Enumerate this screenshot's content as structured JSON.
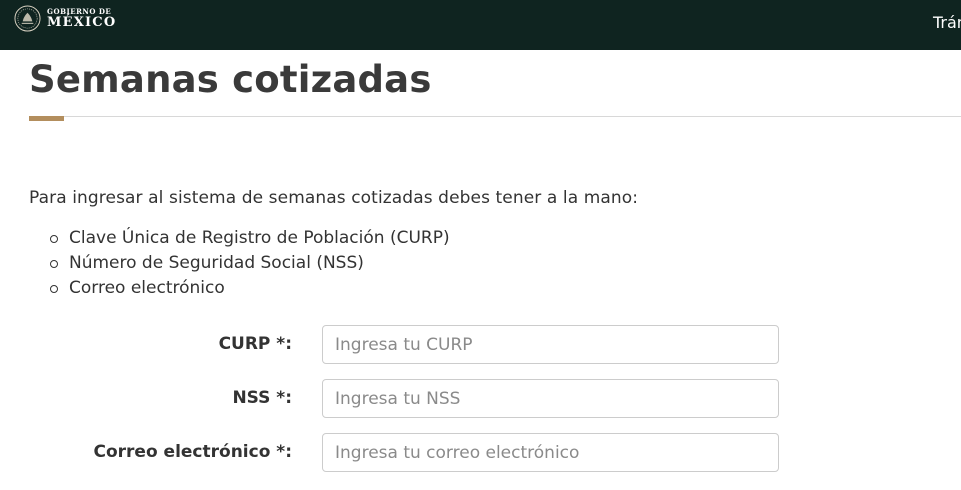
{
  "header": {
    "logo_line1": "GOBIERNO DE",
    "logo_line2": "MÉXICO",
    "nav_link": "Trámites"
  },
  "page": {
    "title": "Semanas cotizadas",
    "intro": "Para ingresar al sistema de semanas cotizadas debes tener a la mano:",
    "requirements": [
      "Clave Única de Registro de Población (CURP)",
      "Número de Seguridad Social (NSS)",
      "Correo electrónico"
    ]
  },
  "form": {
    "curp": {
      "label": "CURP *:",
      "placeholder": "Ingresa tu CURP",
      "value": ""
    },
    "nss": {
      "label": "NSS *:",
      "placeholder": "Ingresa tu NSS",
      "value": ""
    },
    "email": {
      "label": "Correo electrónico *:",
      "placeholder": "Ingresa tu correo electrónico",
      "value": ""
    }
  },
  "colors": {
    "header_bg": "#0f2420",
    "accent": "#b38e5d",
    "text": "#333333"
  }
}
